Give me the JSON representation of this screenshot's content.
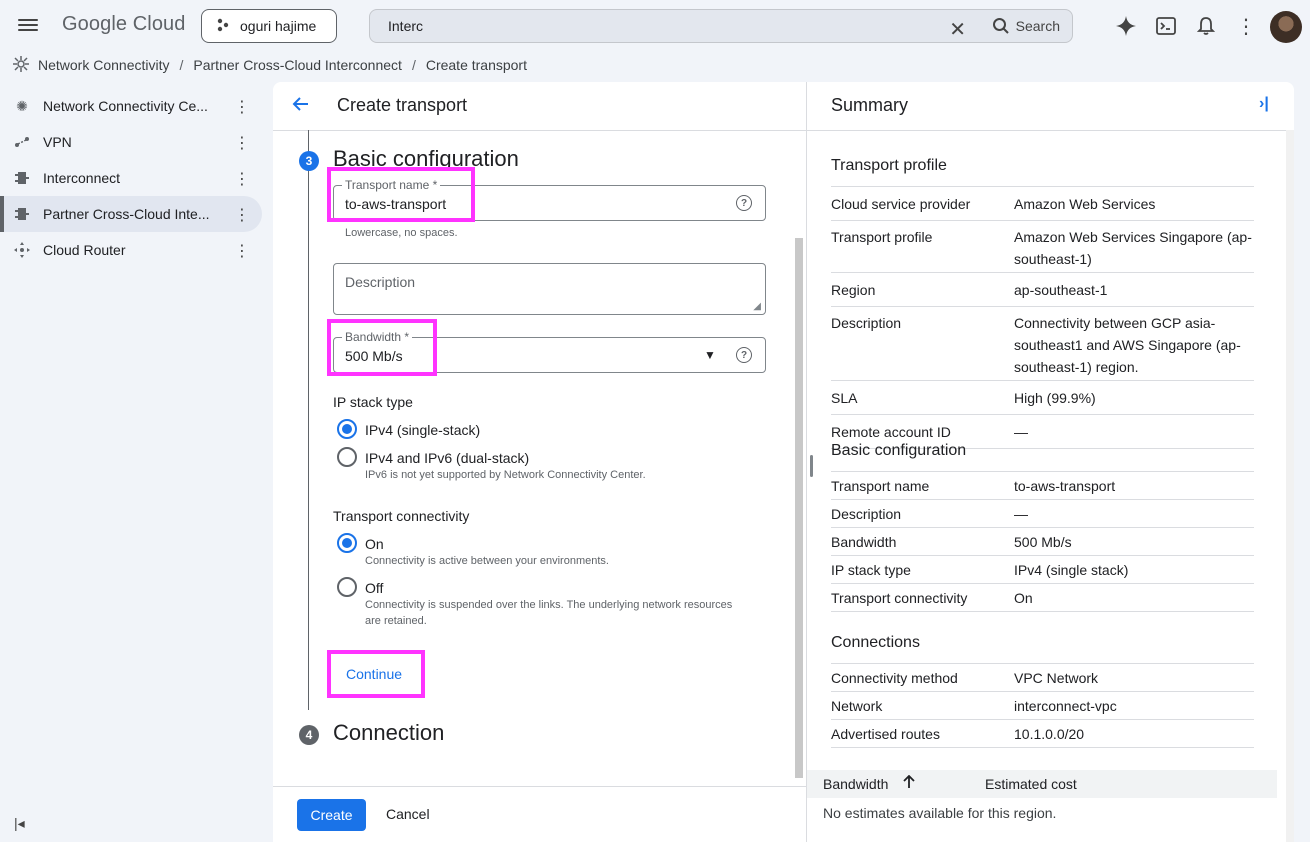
{
  "topbar": {
    "logo": "Google Cloud",
    "project": "oguri hajime",
    "search_value": "Interc",
    "search_label": "Search"
  },
  "breadcrumb": [
    "Network Connectivity",
    "Partner Cross-Cloud Interconnect",
    "Create transport"
  ],
  "nav": {
    "items": [
      {
        "label": "Network Connectivity Ce...",
        "icon": "hub-icon"
      },
      {
        "label": "VPN",
        "icon": "vpn-icon"
      },
      {
        "label": "Interconnect",
        "icon": "interconnect-icon"
      },
      {
        "label": "Partner Cross-Cloud Inte...",
        "icon": "interconnect-icon",
        "active": true
      },
      {
        "label": "Cloud Router",
        "icon": "router-icon"
      }
    ]
  },
  "form": {
    "title": "Create transport",
    "step3": {
      "num": "3",
      "title": "Basic configuration"
    },
    "transport_name": {
      "label": "Transport name *",
      "value": "to-aws-transport",
      "hint": "Lowercase, no spaces."
    },
    "description": {
      "label": "Description"
    },
    "bandwidth": {
      "label": "Bandwidth *",
      "value": "500 Mb/s"
    },
    "ip_stack": {
      "label": "IP stack type",
      "options": [
        {
          "label": "IPv4 (single-stack)",
          "selected": true,
          "hint": ""
        },
        {
          "label": "IPv4 and IPv6 (dual-stack)",
          "selected": false,
          "hint": "IPv6 is not yet supported by Network Connectivity Center."
        }
      ]
    },
    "connectivity": {
      "label": "Transport connectivity",
      "options": [
        {
          "label": "On",
          "selected": true,
          "hint": "Connectivity is active between your environments."
        },
        {
          "label": "Off",
          "selected": false,
          "hint": "Connectivity is suspended over the links. The underlying network resources",
          "hint2": "are retained."
        }
      ]
    },
    "continue_label": "Continue",
    "step4": {
      "num": "4",
      "title": "Connection"
    },
    "create_label": "Create",
    "cancel_label": "Cancel"
  },
  "summary": {
    "title": "Summary",
    "transport_profile": {
      "heading": "Transport profile",
      "rows": [
        {
          "k": "Cloud service provider",
          "v": "Amazon Web Services"
        },
        {
          "k": "Transport profile",
          "v": "Amazon Web Services Singapore (ap-southeast-1)"
        },
        {
          "k": "Region",
          "v": "ap-southeast-1"
        },
        {
          "k": "Description",
          "v": "Connectivity between GCP asia-southeast1 and AWS Singapore (ap-southeast-1) region."
        },
        {
          "k": "SLA",
          "v": "High (99.9%)"
        },
        {
          "k": "Remote account ID",
          "v": "—"
        }
      ]
    },
    "basic": {
      "heading": "Basic configuration",
      "rows": [
        {
          "k": "Transport name",
          "v": "to-aws-transport"
        },
        {
          "k": "Description",
          "v": "—"
        },
        {
          "k": "Bandwidth",
          "v": "500 Mb/s"
        },
        {
          "k": "IP stack type",
          "v": "IPv4 (single stack)"
        },
        {
          "k": "Transport connectivity",
          "v": "On"
        }
      ]
    },
    "connections": {
      "heading": "Connections",
      "rows": [
        {
          "k": "Connectivity method",
          "v": "VPC Network"
        },
        {
          "k": "Network",
          "v": "interconnect-vpc"
        },
        {
          "k": "Advertised routes",
          "v": "10.1.0.0/20"
        }
      ]
    },
    "estimate": {
      "col_bandwidth": "Bandwidth",
      "col_cost": "Estimated cost",
      "empty": "No estimates available for this region."
    }
  },
  "colors": {
    "accent": "#1a73e8",
    "highlight": "#ff33ff",
    "step_active": "#1a73e8",
    "step_inactive": "#5f6368"
  }
}
